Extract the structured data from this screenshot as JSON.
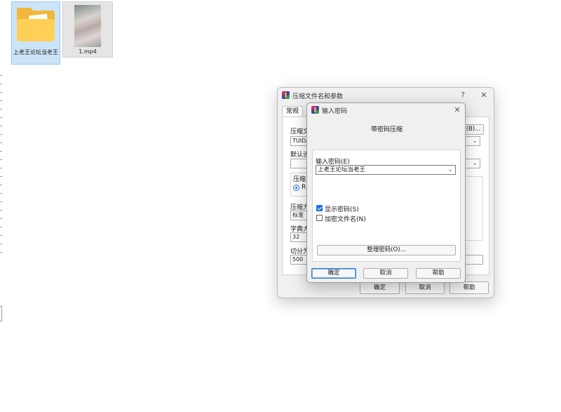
{
  "desktop": {
    "items": [
      {
        "label": "上老王论坛当老王",
        "icon": "folder-icon",
        "selected": true
      },
      {
        "label": "1.mp4",
        "icon": "video-thumbnail"
      }
    ]
  },
  "archive_dialog": {
    "title": "压缩文件名和参数",
    "help_button": "?",
    "close_button": "✕",
    "tabs": [
      {
        "label": "常规"
      }
    ],
    "archive_name_label": "压缩文",
    "archive_name_value": "TUIDA",
    "browse_button": "(B)...",
    "default_profile_label": "默认设",
    "format_group_label": "压缩",
    "format_radio_label": "R",
    "method_label": "压缩方",
    "method_value": "标准",
    "dict_label": "字典大",
    "dict_value": "32",
    "split_label": "切分为",
    "split_value": "500",
    "buttons": {
      "ok": "确定",
      "cancel": "取消",
      "help": "帮助"
    }
  },
  "password_dialog": {
    "title": "输入密码",
    "close_button": "✕",
    "heading": "带密码压缩",
    "password_label": "输入密码(E)",
    "password_value": "上老王论坛当老王",
    "show_password": {
      "label": "显示密码(S)",
      "checked": true
    },
    "encrypt_filenames": {
      "label": "加密文件名(N)",
      "checked": false
    },
    "organize_button": "整理密码(O)...",
    "buttons": {
      "ok": "确定",
      "cancel": "取消",
      "help": "帮助"
    }
  },
  "colors": {
    "accent": "#1a73e8",
    "folder": "#f0b73a",
    "selection": "#cce4f7"
  }
}
